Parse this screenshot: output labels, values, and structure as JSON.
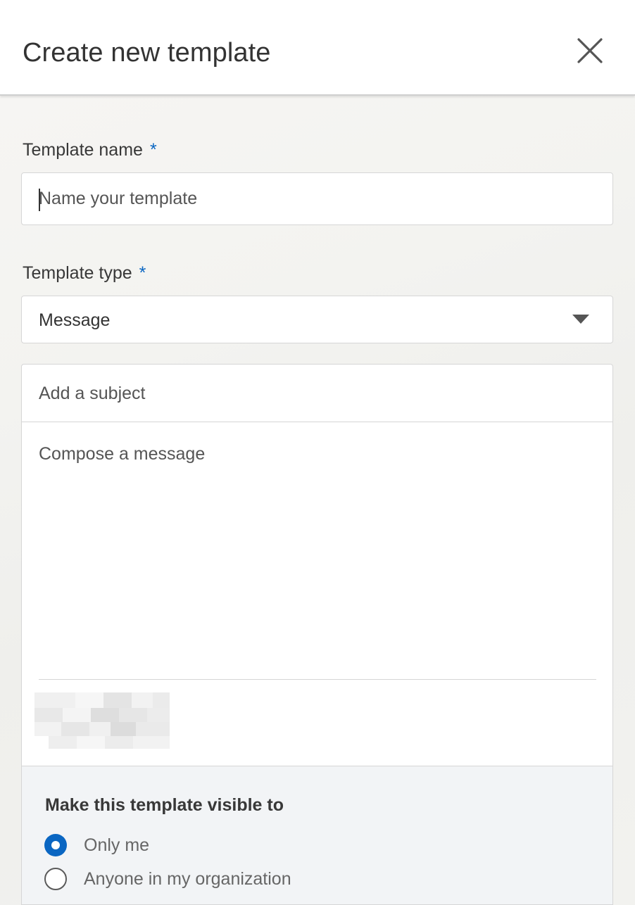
{
  "dialog": {
    "title": "Create new template",
    "close_icon": "close-icon"
  },
  "form": {
    "name": {
      "label": "Template name",
      "required_marker": "*",
      "value": "",
      "placeholder": "Name your template"
    },
    "type": {
      "label": "Template type",
      "required_marker": "*",
      "selected": "Message",
      "dropdown_icon": "caret-down-icon"
    },
    "subject": {
      "value": "",
      "placeholder": "Add a subject"
    },
    "message": {
      "value": "",
      "placeholder": "Compose a message"
    },
    "signature": {
      "redacted": true
    },
    "visibility": {
      "title": "Make this template visible to",
      "options": [
        {
          "label": "Only me",
          "checked": true
        },
        {
          "label": "Anyone in my organization",
          "checked": false
        }
      ]
    }
  },
  "colors": {
    "accent": "#0a66c2",
    "text": "#333333",
    "border": "#d6d6d6",
    "visibility_bg": "#f2f4f6"
  }
}
